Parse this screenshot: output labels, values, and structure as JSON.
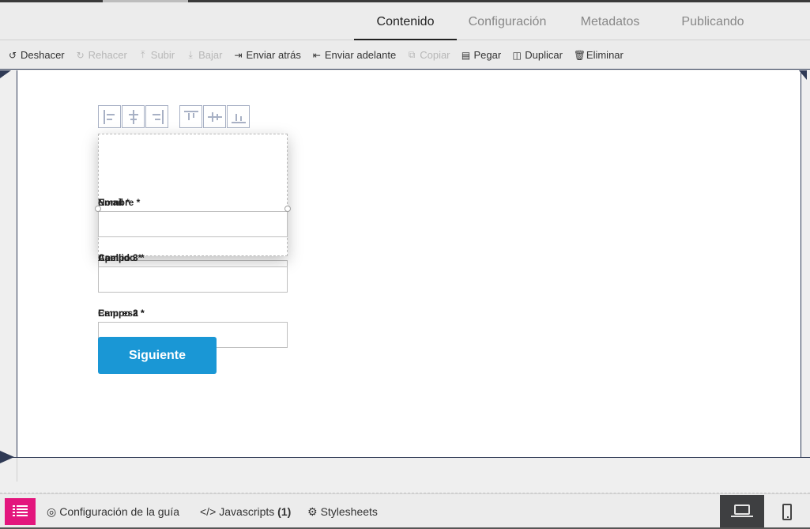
{
  "tabs": [
    "Contenido",
    "Configuración",
    "Metadatos",
    "Publicando"
  ],
  "active_tab": "Contenido",
  "toolbar": {
    "undo": "Deshacer",
    "redo": "Rehacer",
    "up": "Subir",
    "down": "Bajar",
    "send_back": "Enviar atrás",
    "send_forward": "Enviar adelante",
    "copy": "Copiar",
    "paste": "Pegar",
    "duplicate": "Duplicar",
    "delete": "Eliminar"
  },
  "form": {
    "label_1": "Nombre *",
    "label_1_overlap": "Email *",
    "label_2": "Campo 3 *",
    "label_2_overlap": "Apellido *",
    "label_3": "Campo 2 *",
    "label_3_overlap": "Empresa *",
    "next_button": "Siguiente"
  },
  "bottombar": {
    "guide_config": "Configuración de la guía",
    "javascripts": "Javascripts",
    "javascripts_count": "(1)",
    "stylesheets": "Stylesheets"
  }
}
